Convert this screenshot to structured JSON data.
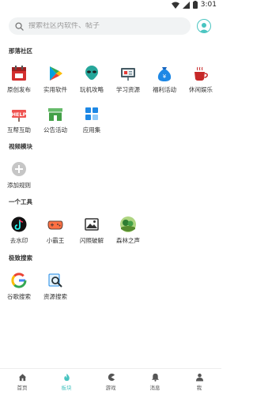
{
  "status": {
    "time": "3:01"
  },
  "search": {
    "placeholder": "搜索社区内软件、帖子"
  },
  "sections": {
    "community": {
      "title": "那落社区",
      "items": [
        "原创发布",
        "实用软件",
        "玩机攻略",
        "学习资源",
        "福利活动",
        "休闲娱乐",
        "互帮互助",
        "公告活动",
        "应用集"
      ]
    },
    "video": {
      "title": "视频模块",
      "items": [
        "添加规则"
      ]
    },
    "tools": {
      "title": "一个工具",
      "items": [
        "去水印",
        "小霸王",
        "闪照破解",
        "森林之声"
      ]
    },
    "search_mod": {
      "title": "极致搜索",
      "items": [
        "谷歌搜索",
        "资源搜索"
      ]
    }
  },
  "nav": {
    "items": [
      "首页",
      "板块",
      "游戏",
      "消息",
      "我"
    ],
    "active": "板块"
  },
  "colors": {
    "accent": "#48c4c0"
  }
}
